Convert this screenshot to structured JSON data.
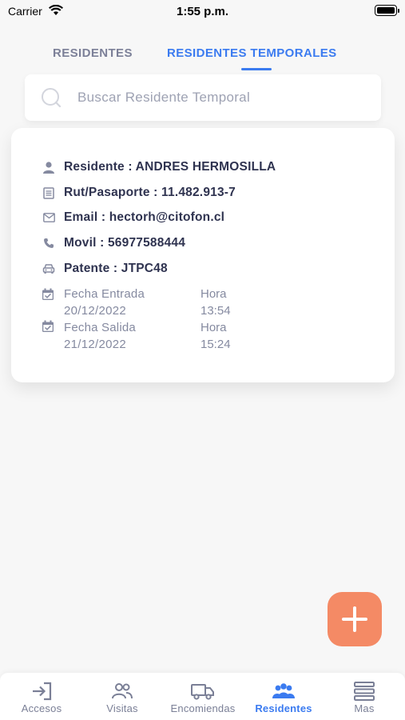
{
  "status": {
    "carrier": "Carrier",
    "time": "1:55 p.m."
  },
  "tabs": [
    {
      "label": "RESIDENTES"
    },
    {
      "label": "RESIDENTES TEMPORALES"
    }
  ],
  "search": {
    "placeholder": "Buscar Residente Temporal",
    "value": ""
  },
  "card": {
    "residente": "Residente :  ANDRES HERMOSILLA",
    "rut": "Rut/Pasaporte : 11.482.913-7",
    "email": "Email : hectorh@citofon.cl",
    "movil": "Movil : 56977588444",
    "patente": "Patente : JTPC48",
    "entrada_label": "Fecha Entrada",
    "entrada_fecha": "20/12/2022",
    "entrada_hora_label": "Hora",
    "entrada_hora": "13:54",
    "salida_label": "Fecha Salida",
    "salida_fecha": "21/12/2022",
    "salida_hora_label": "Hora",
    "salida_hora": "15:24"
  },
  "tabbar": [
    {
      "label": "Accesos",
      "icon": "login-icon"
    },
    {
      "label": "Visitas",
      "icon": "users-icon"
    },
    {
      "label": "Encomiendas",
      "icon": "truck-icon"
    },
    {
      "label": "Residentes",
      "icon": "group-icon"
    },
    {
      "label": "Mas",
      "icon": "menu-icon"
    }
  ],
  "colors": {
    "accent": "#3b7bf0",
    "fab": "#f48a65",
    "text": "#2f3350",
    "muted": "#858aa0"
  }
}
